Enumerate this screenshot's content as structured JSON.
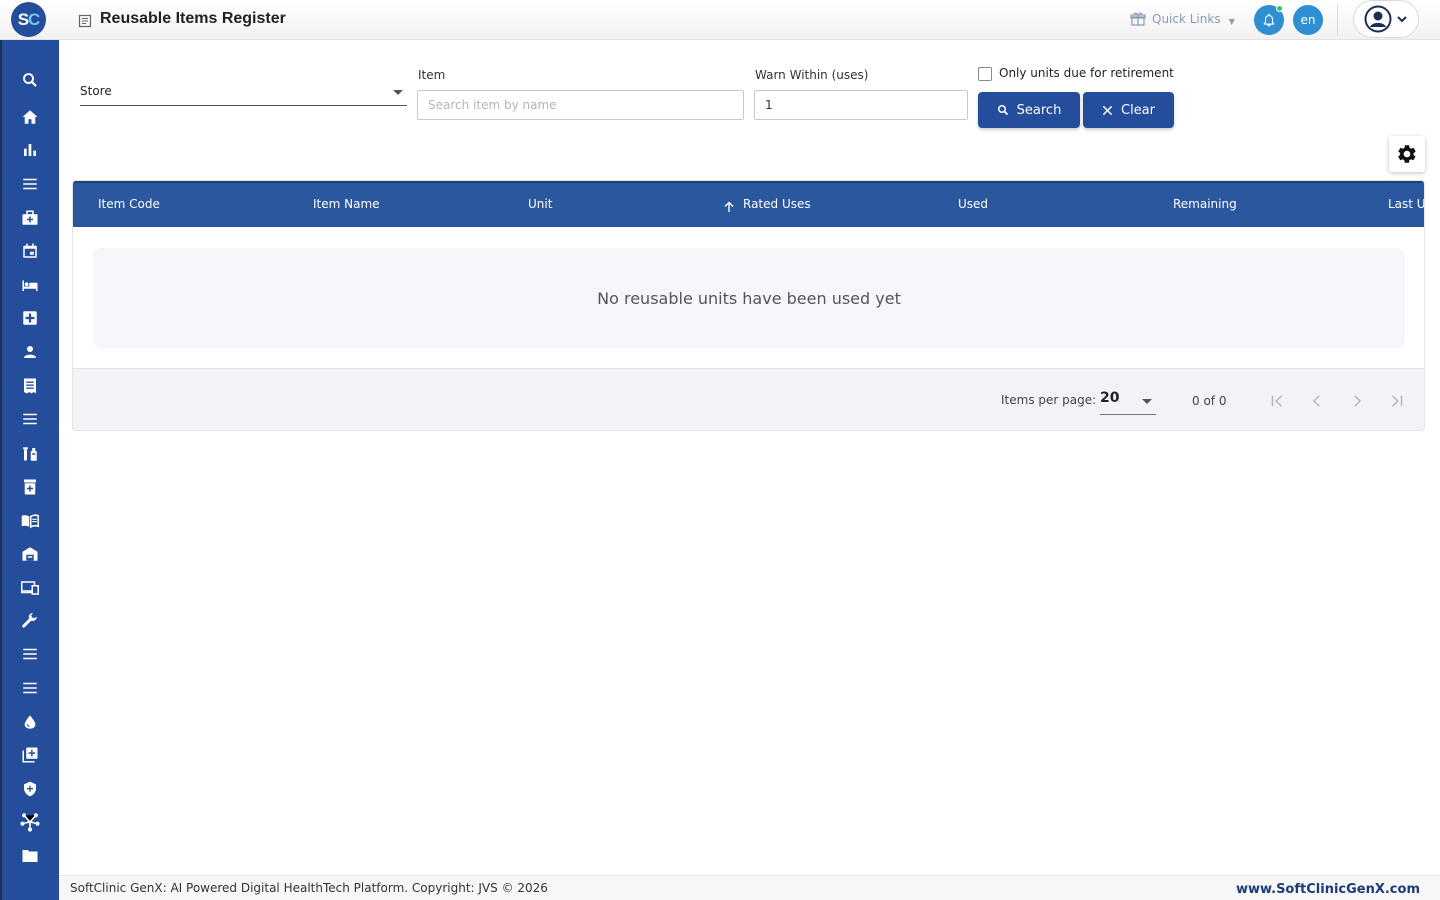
{
  "app": {
    "logo_s": "S",
    "logo_c": "C",
    "page_title": "Reusable Items Register"
  },
  "header": {
    "quick_links_label": "Quick Links",
    "language": "en"
  },
  "sidebar": {
    "items": [
      {
        "icon": "search-icon"
      },
      {
        "icon": "home-icon"
      },
      {
        "icon": "bar-chart-icon"
      },
      {
        "icon": "menu-icon"
      },
      {
        "icon": "medical-bag-icon"
      },
      {
        "icon": "calendar-icon"
      },
      {
        "icon": "bed-icon"
      },
      {
        "icon": "medical-plus-icon"
      },
      {
        "icon": "person-icon"
      },
      {
        "icon": "receipt-icon"
      },
      {
        "icon": "menu-icon"
      },
      {
        "icon": "lab-icon"
      },
      {
        "icon": "pharmacy-icon"
      },
      {
        "icon": "book-icon"
      },
      {
        "icon": "warehouse-icon"
      },
      {
        "icon": "devices-icon"
      },
      {
        "icon": "wrench-icon"
      },
      {
        "icon": "menu-icon"
      },
      {
        "icon": "menu-icon"
      },
      {
        "icon": "blood-drop-icon"
      },
      {
        "icon": "add-box-icon"
      },
      {
        "icon": "shield-icon"
      },
      {
        "icon": "network-icon"
      },
      {
        "icon": "folder-icon"
      }
    ]
  },
  "filters": {
    "store_label": "Store",
    "item_label": "Item",
    "item_placeholder": "Search item by name",
    "warn_label": "Warn Within (uses)",
    "warn_value": "1",
    "retirement_label": "Only units due for retirement",
    "search_button": "Search",
    "clear_button": "Clear"
  },
  "table": {
    "columns": [
      "Item Code",
      "Item Name",
      "Unit",
      "Rated Uses",
      "Used",
      "Remaining",
      "Last U"
    ],
    "empty_message": "No reusable units have been used yet"
  },
  "paginator": {
    "items_per_page_label": "Items per page:",
    "page_size": "20",
    "range": "0 of 0"
  },
  "footer": {
    "copyright": "SoftClinic GenX: AI Powered Digital HealthTech Platform. Copyright: JVS © 2026",
    "website": "www.SoftClinicGenX.com"
  },
  "colors": {
    "primary": "#244e9c",
    "table_header": "#2b579f",
    "accent_blue": "#2e8fd1",
    "notification_dot": "#2ecc71"
  }
}
